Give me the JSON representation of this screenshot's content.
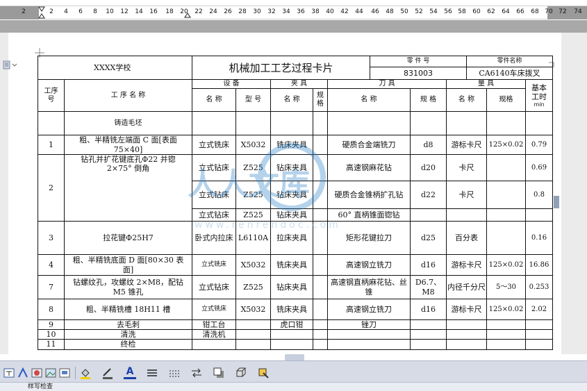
{
  "ruler": {
    "ticks": [
      "2",
      "",
      "2",
      "4",
      "6",
      "8",
      "10",
      "12",
      "14",
      "16",
      "18",
      "20",
      "22",
      "24",
      "26",
      "28",
      "30",
      "32",
      "34",
      "36",
      "38",
      "40",
      "42",
      "44",
      "46",
      "48",
      "50",
      "52",
      "54",
      "56",
      "58",
      "60",
      "62",
      "64",
      "66",
      "68",
      "70",
      "72",
      "74"
    ]
  },
  "card": {
    "school": "XXXX学校",
    "title": "机械加工工艺过程卡片",
    "part_no_label": "零 件 号",
    "part_no_value": "831003",
    "part_name_label": "零件名称",
    "part_name_value": "CA6140车床拨叉"
  },
  "headers": {
    "seq": "工序\n号",
    "op_name": "工  序  名  称",
    "equipment": "设    备",
    "fixture": "夹  具",
    "tool": "刀  具",
    "gauge": "量  具",
    "basic_time": "基本\n工时",
    "time_unit": "min",
    "eq_name": "名  称",
    "eq_model": "型 号",
    "fx_name": "名  称",
    "fx_spec": "规\n格",
    "tool_name": "名  称",
    "tool_spec": "规  格",
    "gauge_name": "名  称",
    "gauge_spec": "规格"
  },
  "rows": [
    {
      "seq": "",
      "op": "铸造毛坯",
      "eq": "",
      "model": "",
      "fixture": "",
      "tool": "",
      "tspec": "",
      "gauge": "",
      "gspec": "",
      "time": ""
    },
    {
      "seq": "1",
      "op": "粗、半精铣左端面 C 面[表面 75×40]",
      "eq": "立式铣床",
      "model": "X5032",
      "fixture": "铣床夹具",
      "tool": "硬质合金端铣刀",
      "tspec": "d8",
      "gauge": "游标卡尺",
      "gspec": "125×0.02",
      "time": "0.79"
    },
    {
      "seq": "2",
      "op": "钻孔并扩花键底孔Φ22 并锪 2×75° 倒角",
      "eq": "立式钻床",
      "model": "Z525",
      "fixture": "钻床夹具",
      "tool": "高速钢麻花钻",
      "tspec": "d20",
      "gauge": "卡尺",
      "gspec": "",
      "time": "0.69"
    },
    {
      "seq": "",
      "op": "",
      "eq": "立式钻床",
      "model": "Z525",
      "fixture": "钻床夹具",
      "tool": "硬质合金锥柄扩孔钻",
      "tspec": "d22",
      "gauge": "卡尺",
      "gspec": "",
      "time": "0.8"
    },
    {
      "seq": "",
      "op": "",
      "eq": "立式钻床",
      "model": "Z525",
      "fixture": "钻床夹具",
      "tool": "60° 直柄锥面锪钻",
      "tspec": "",
      "gauge": "",
      "gspec": "",
      "time": ""
    },
    {
      "seq": "3",
      "op": "拉花键Φ25H7",
      "eq": "卧式内拉床",
      "model": "L6110A",
      "fixture": "拉床夹具",
      "tool": "矩形花键拉刀",
      "tspec": "d25",
      "gauge": "百分表",
      "gspec": "",
      "time": "0.16"
    },
    {
      "seq": "4",
      "op": "粗、半精铣底面 D 面[80×30 表面]",
      "eq": "立式铣床",
      "model": "X5032",
      "fixture": "铣床夹具",
      "tool": "高速钢立铣刀",
      "tspec": "d16",
      "gauge": "游标卡尺",
      "gspec": "125×0.02",
      "time": "16.86"
    },
    {
      "seq": "7",
      "op": "钻螺纹孔，攻螺纹 2×M8，配钻M5 锥孔",
      "eq": "立式钻床",
      "model": "Z525",
      "fixture": "钻床夹具",
      "tool": "高速钢直柄麻花钻、丝锥",
      "tspec": "D6.7、M8",
      "gauge": "内径千分尺",
      "gspec": "5～30",
      "time": "0.253"
    },
    {
      "seq": "8",
      "op": "粗、半精铣槽 18H11 槽",
      "eq": "立式铣床",
      "model": "X5032",
      "fixture": "铣床夹具",
      "tool": "高速钢立铣刀",
      "tspec": "d16",
      "gauge": "游标卡尺",
      "gspec": "125×0.02",
      "time": "2.02"
    },
    {
      "seq": "9",
      "op": "去毛刺",
      "eq": "钳工台",
      "model": "",
      "fixture": "虎口钳",
      "tool": "锉刀",
      "tspec": "",
      "gauge": "",
      "gspec": "",
      "time": ""
    },
    {
      "seq": "10",
      "op": "清洗",
      "eq": "清洗机",
      "model": "",
      "fixture": "",
      "tool": "",
      "tspec": "",
      "gauge": "",
      "gspec": "",
      "time": ""
    },
    {
      "seq": "11",
      "op": "终检",
      "eq": "",
      "model": "",
      "fixture": "",
      "tool": "",
      "tspec": "",
      "gauge": "",
      "gspec": "",
      "time": ""
    }
  ],
  "watermark": {
    "text": "人人文库",
    "url": "www.renrendoc.com"
  },
  "toolbar": {
    "icons": [
      "text-box-icon",
      "wordart-icon",
      "clipart-icon",
      "picture-icon",
      "diagram-icon",
      "fill-color-icon",
      "line-color-icon",
      "font-color-icon",
      "line-style-icon",
      "dash-style-icon",
      "arrow-style-icon",
      "shadow-icon",
      "3d-style-icon",
      "select-objects-icon"
    ],
    "font_color_glyph": "A"
  },
  "status": {
    "text": "样写检查"
  }
}
